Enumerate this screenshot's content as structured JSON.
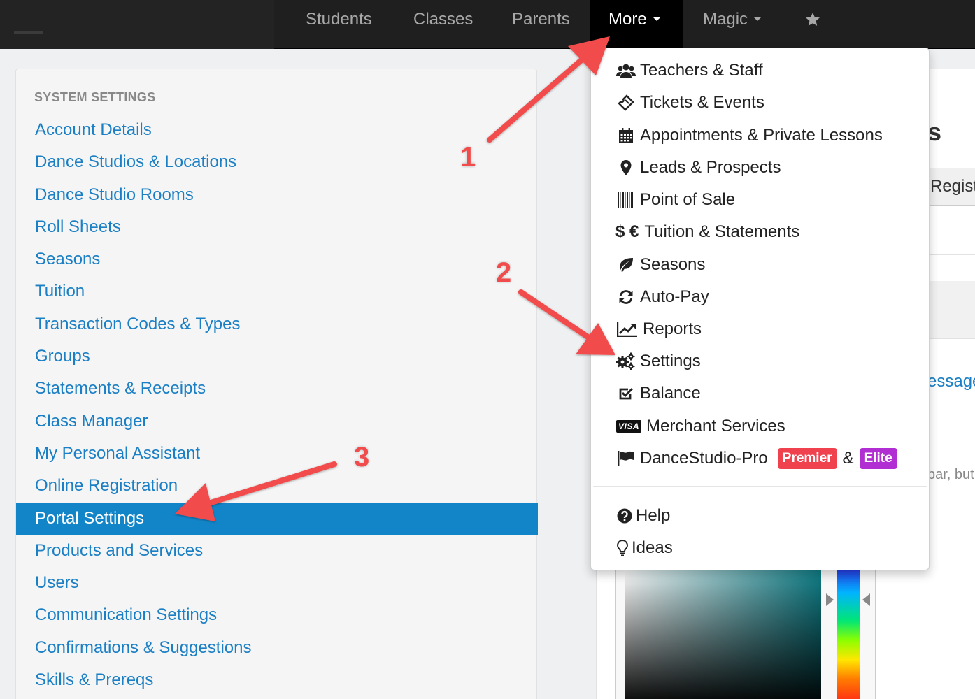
{
  "navbar": {
    "items": [
      {
        "label": "Students"
      },
      {
        "label": "Classes"
      },
      {
        "label": "Parents"
      },
      {
        "label": "More"
      },
      {
        "label": "Magic"
      }
    ],
    "star_icon": "star-icon"
  },
  "sidebar": {
    "header": "SYSTEM SETTINGS",
    "items": [
      {
        "label": "Account Details"
      },
      {
        "label": "Dance Studios & Locations"
      },
      {
        "label": "Dance Studio Rooms"
      },
      {
        "label": "Roll Sheets"
      },
      {
        "label": "Seasons"
      },
      {
        "label": "Tuition"
      },
      {
        "label": "Transaction Codes & Types"
      },
      {
        "label": "Groups"
      },
      {
        "label": "Statements & Receipts"
      },
      {
        "label": "Class Manager"
      },
      {
        "label": "My Personal Assistant"
      },
      {
        "label": "Online Registration"
      },
      {
        "label": "Portal Settings"
      },
      {
        "label": "Products and Services"
      },
      {
        "label": "Users"
      },
      {
        "label": "Communication Settings"
      },
      {
        "label": "Confirmations & Suggestions"
      },
      {
        "label": "Skills & Prereqs"
      }
    ],
    "active_label": "Portal Settings"
  },
  "dropdown": {
    "items": [
      {
        "label": "Teachers & Staff",
        "icon": "users-icon"
      },
      {
        "label": "Tickets & Events",
        "icon": "ticket-icon"
      },
      {
        "label": "Appointments & Private Lessons",
        "icon": "calendar-icon"
      },
      {
        "label": "Leads & Prospects",
        "icon": "map-marker-icon"
      },
      {
        "label": "Point of Sale",
        "icon": "barcode-icon"
      },
      {
        "label": "Tuition & Statements",
        "icon": "currency-icon"
      },
      {
        "label": "Seasons",
        "icon": "leaf-icon"
      },
      {
        "label": "Auto-Pay",
        "icon": "refresh-icon"
      },
      {
        "label": "Reports",
        "icon": "line-chart-icon"
      },
      {
        "label": "Settings",
        "icon": "gears-icon"
      },
      {
        "label": "Balance",
        "icon": "check-square-icon"
      },
      {
        "label": "Merchant Services",
        "icon": "visa-card-icon"
      },
      {
        "label": "DanceStudio-Pro",
        "icon": "flag-icon"
      }
    ],
    "currency_symbols": "$ €",
    "visa_text": "VISA",
    "badges": {
      "premier": "Premier",
      "ampersand": "&",
      "elite": "Elite"
    },
    "footer_items": [
      {
        "label": "Help",
        "icon": "question-circle-icon"
      },
      {
        "label": "Ideas",
        "icon": "lightbulb-icon"
      }
    ]
  },
  "background": {
    "heading_fragment": "s",
    "button_fragment": "Regist",
    "link_fragment": "essage",
    "text_fragment": "bar, but"
  },
  "annotations": {
    "arrow1": "1",
    "arrow2": "2",
    "arrow3": "3",
    "color": "#f24b4b"
  },
  "colors": {
    "link": "#1a7fc4",
    "active_row": "#1285c9",
    "navbar": "#1f1f1f",
    "premier_badge": "#f0414f",
    "elite_badge": "#b12ed3"
  }
}
